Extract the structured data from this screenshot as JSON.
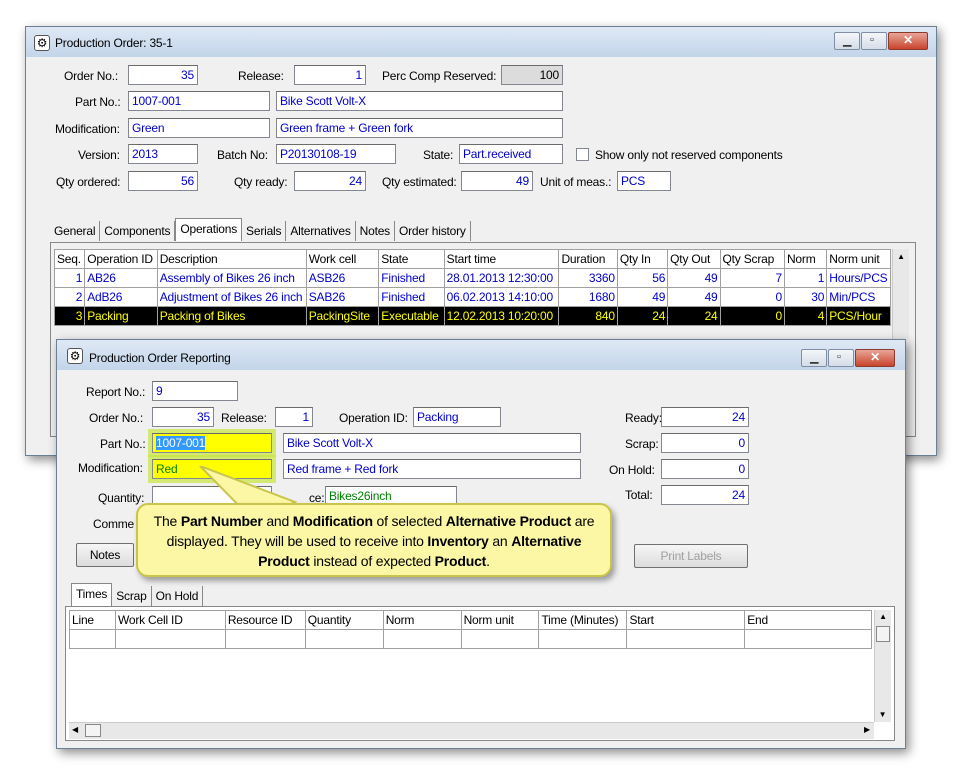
{
  "w1": {
    "title": "Production Order: 35-1",
    "labels": {
      "order_no": "Order No.:",
      "release": "Release:",
      "perc": "Perc Comp Reserved:",
      "part_no": "Part No.:",
      "modification": "Modification:",
      "version": "Version:",
      "batch": "Batch No:",
      "state": "State:",
      "show_only": "Show only not reserved components",
      "qty_ordered": "Qty ordered:",
      "qty_ready": "Qty ready:",
      "qty_est": "Qty estimated:",
      "uom": "Unit of meas.:"
    },
    "values": {
      "order_no": "35",
      "release": "1",
      "perc": "100",
      "part_no": "1007-001",
      "part_desc": "Bike Scott Volt-X",
      "modification": "Green",
      "mod_desc": "Green frame + Green fork",
      "version": "2013",
      "batch": "P20130108-19",
      "state": "Part.received",
      "qty_ordered": "56",
      "qty_ready": "24",
      "qty_est": "49",
      "uom": "PCS"
    },
    "tabs": [
      "General",
      "Components",
      "Operations",
      "Serials",
      "Alternatives",
      "Notes",
      "Order history"
    ],
    "columns": [
      "Seq.",
      "Operation ID",
      "Description",
      "Work cell",
      "State",
      "Start time",
      "Duration",
      "Qty In",
      "Qty Out",
      "Qty Scrap",
      "Norm",
      "Norm unit"
    ],
    "rows": [
      [
        "1",
        "AB26",
        "Assembly of Bikes 26 inch",
        "ASB26",
        "Finished",
        "28.01.2013 12:30:00",
        "3360",
        "56",
        "49",
        "7",
        "1",
        "Hours/PCS"
      ],
      [
        "2",
        "AdB26",
        "Adjustment of Bikes 26 inch",
        "SAB26",
        "Finished",
        "06.02.2013 14:10:00",
        "1680",
        "49",
        "49",
        "0",
        "30",
        "Min/PCS"
      ],
      [
        "3",
        "Packing",
        "Packing of Bikes",
        "PackingSite",
        "Executable",
        "12.02.2013 10:20:00",
        "840",
        "24",
        "24",
        "0",
        "4",
        "PCS/Hour"
      ]
    ]
  },
  "w2": {
    "title": "Production Order Reporting",
    "labels": {
      "report_no": "Report No.:",
      "order_no": "Order No.:",
      "release": "Release:",
      "operation_id": "Operation ID:",
      "part_no": "Part No.:",
      "modification": "Modification:",
      "quantity": "Quantity:",
      "comment": "Comme",
      "ready": "Ready:",
      "scrap": "Scrap:",
      "on_hold": "On Hold:",
      "total": "Total:",
      "work_cell_partial": "ce:"
    },
    "values": {
      "report_no": "9",
      "order_no": "35",
      "release": "1",
      "operation_id": "Packing",
      "part_no": "1007-001",
      "part_desc": "Bike Scott Volt-X",
      "modification": "Red",
      "mod_desc": "Red frame + Red fork",
      "work_cell": "Bikes26inch",
      "ready": "24",
      "scrap": "0",
      "on_hold": "0",
      "total": "24"
    },
    "buttons": {
      "notes": "Notes",
      "print_labels": "Print Labels"
    },
    "tabs": [
      "Times",
      "Scrap",
      "On Hold"
    ],
    "columns": [
      "Line",
      "Work Cell ID",
      "Resource ID",
      "Quantity",
      "Norm",
      "Norm unit",
      "Time (Minutes)",
      "Start",
      "End"
    ]
  },
  "callout": {
    "p1": "The ",
    "b1": "Part Number",
    "p2": " and ",
    "b2": "Modification",
    "p3": " of selected ",
    "b3": "Alternative Product",
    "p4": " are displayed. They will be used to receive into ",
    "b4": "Inventory",
    "p5": " an ",
    "b5": "Alternative Product",
    "p6": " instead of expected ",
    "b6": "Product",
    "p7": "."
  }
}
